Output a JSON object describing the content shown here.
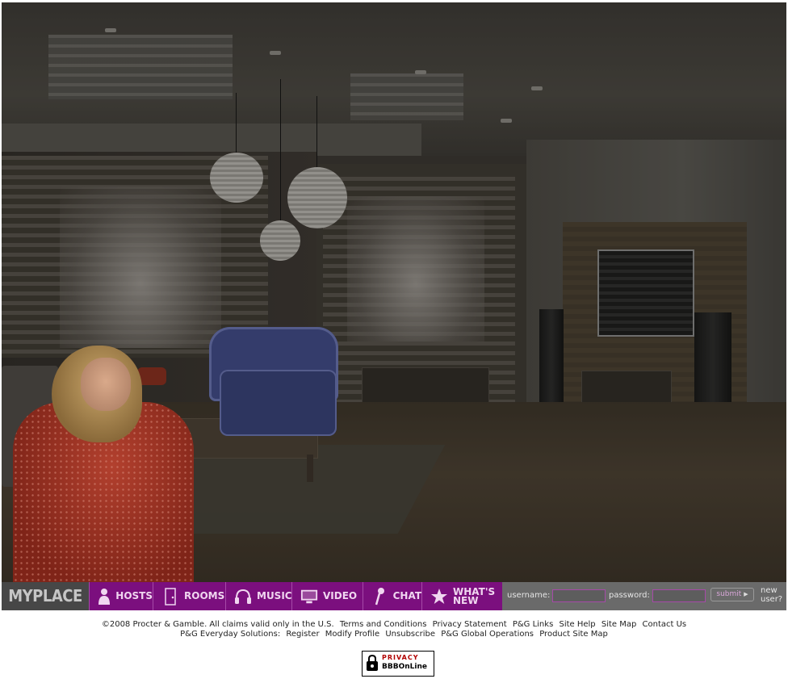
{
  "nav": {
    "brand": "MYPLACE",
    "items": [
      {
        "label": "HOSTS",
        "icon": "person-icon"
      },
      {
        "label": "ROOMS",
        "icon": "door-icon"
      },
      {
        "label": "MUSIC",
        "icon": "headphones-icon"
      },
      {
        "label": "VIDEO",
        "icon": "monitor-icon"
      },
      {
        "label": "CHAT",
        "icon": "microphone-icon"
      },
      {
        "label_line1": "WHAT'S",
        "label_line2": "NEW",
        "icon": "star-icon"
      }
    ],
    "login": {
      "username_label": "username:",
      "password_label": "password:",
      "submit_label": "submit",
      "new_user_line1": "new",
      "new_user_line2": "user?"
    }
  },
  "footer": {
    "line1": [
      "©2008 Procter & Gamble. All claims valid only in the U.S.",
      "Terms and Conditions",
      "Privacy Statement",
      "P&G Links",
      "Site Help",
      "Site Map",
      "Contact Us"
    ],
    "line2": [
      "P&G Everyday Solutions:",
      "Register",
      "Modify Profile",
      "Unsubscribe",
      "P&G Global Operations",
      "Product Site Map"
    ],
    "seal_top": "PRIVACY",
    "seal_bottom": "BBBOnLine"
  },
  "colors": {
    "nav_purple": "#7b0f7e",
    "nav_gray": "#5a5a5a",
    "brand_bg": "#474747"
  }
}
